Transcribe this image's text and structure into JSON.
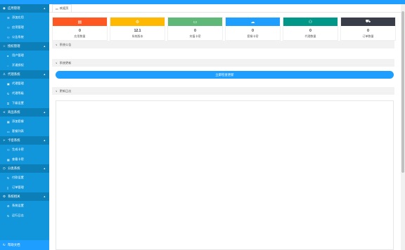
{
  "sidebar": {
    "groups": [
      {
        "label": "应用管理",
        "items": [
          "添加应用",
          "应用管理",
          "公告系统"
        ]
      },
      {
        "label": "授权管理",
        "items": [
          "用户管理",
          "开通授权"
        ]
      },
      {
        "label": "代理系统",
        "items": [
          "代理管理",
          "代理等级",
          "下级设置"
        ]
      },
      {
        "label": "商品系统",
        "items": [
          "添加套餐",
          "套餐列表"
        ]
      },
      {
        "label": "卡密系统",
        "items": [
          "生成卡密",
          "查看卡密"
        ]
      },
      {
        "label": "分类系统",
        "items": [
          "付款设置",
          "订单管理"
        ]
      },
      {
        "label": "系统相关",
        "items": [
          "系统设置",
          "运行日志"
        ]
      }
    ],
    "bottom_label": "帮助文档"
  },
  "tab": {
    "label": "欢迎页"
  },
  "stats": [
    {
      "value": "0",
      "label": "应用数量",
      "color": "#FF5722",
      "icon": "calendar-icon"
    },
    {
      "value": "12.1",
      "label": "系统版本",
      "color": "#FFB800",
      "icon": "gear-icon"
    },
    {
      "value": "0",
      "label": "充值卡密",
      "color": "#5FB878",
      "icon": "card-icon"
    },
    {
      "value": "0",
      "label": "套餐卡密",
      "color": "#1E9FFF",
      "icon": "cloud-icon"
    },
    {
      "value": "0",
      "label": "代理数量",
      "color": "#009688",
      "icon": "users-icon"
    },
    {
      "value": "0",
      "label": "订单数量",
      "color": "#393D49",
      "icon": "cart-icon"
    }
  ],
  "panels": {
    "notice": "系统公告",
    "update": "系统更新",
    "update_button": "立即检查更新",
    "changelog": "更新日志"
  }
}
